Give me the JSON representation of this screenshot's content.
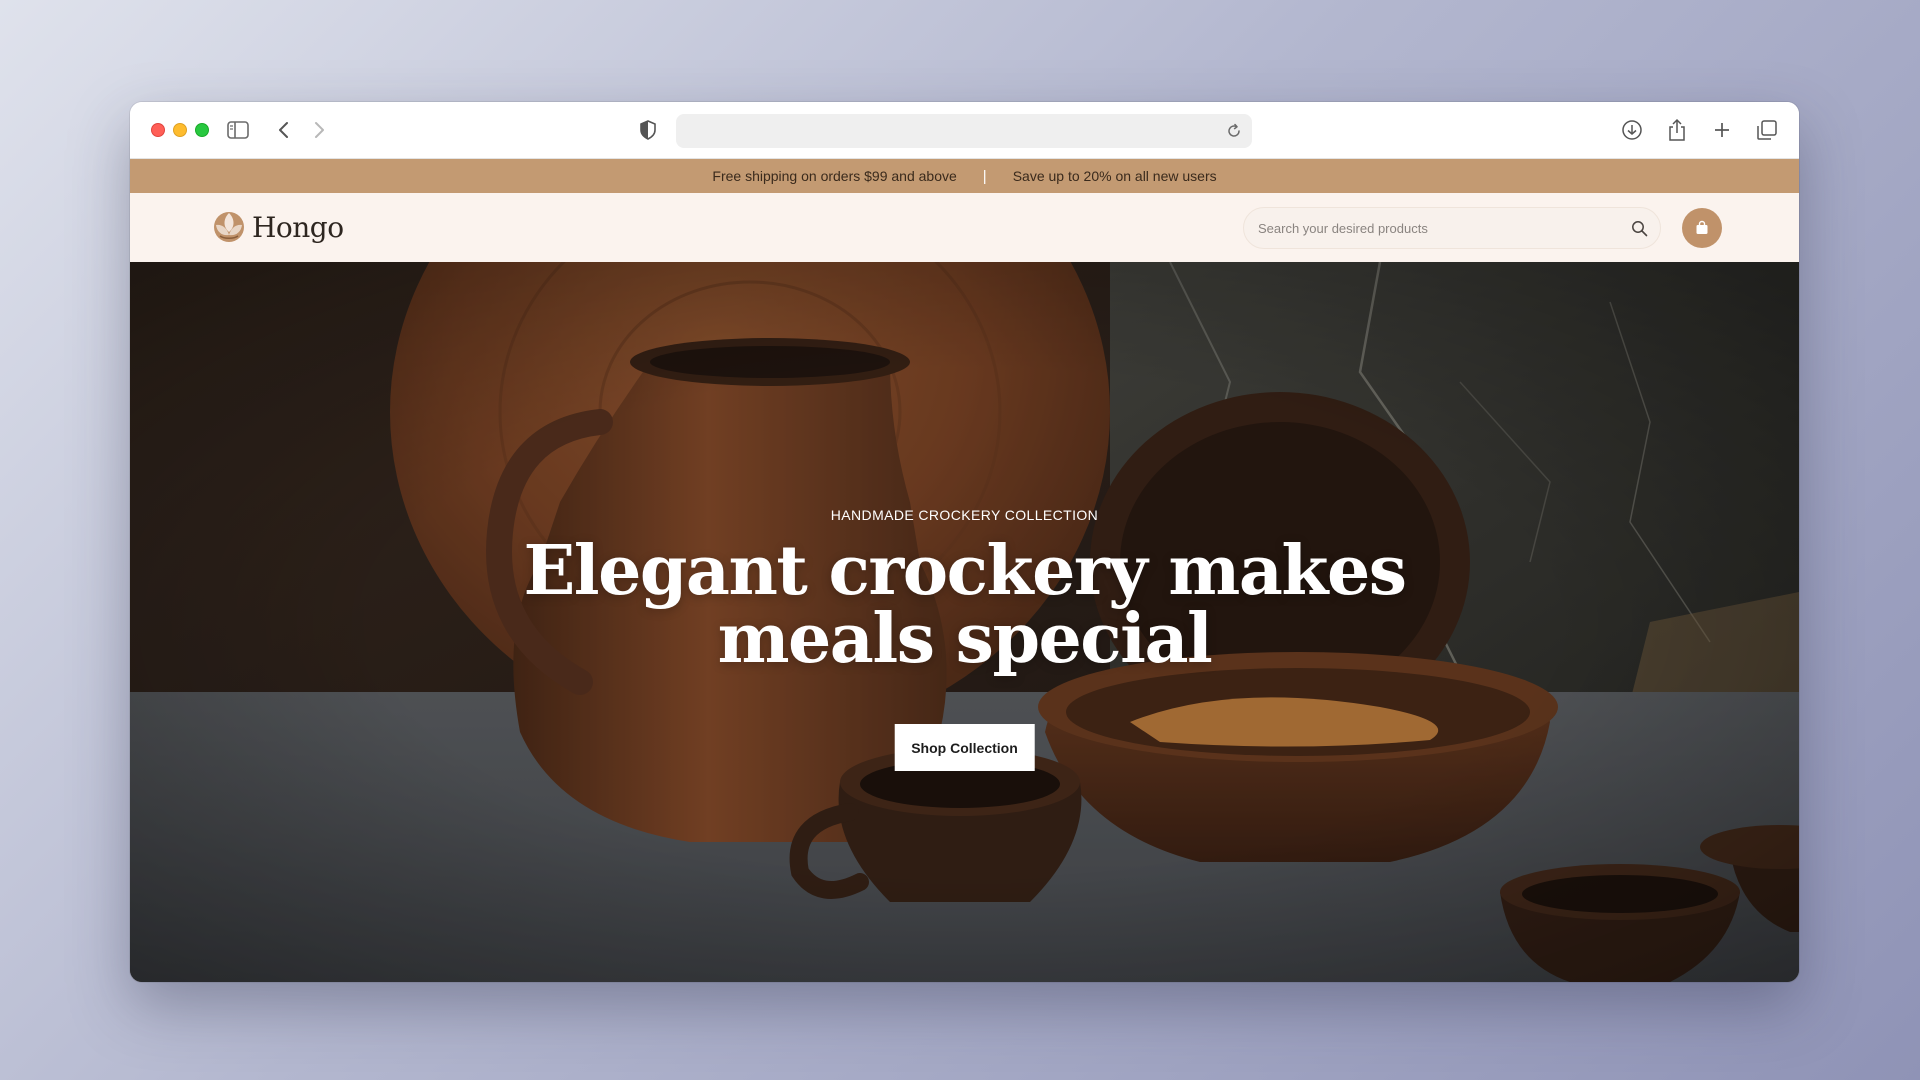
{
  "browser": {
    "address_value": "",
    "icons": [
      "sidebar-icon",
      "back-icon",
      "forward-icon",
      "shield-icon",
      "reload-icon",
      "download-icon",
      "share-icon",
      "new-tab-icon",
      "tabs-overview-icon"
    ]
  },
  "promo": {
    "shipping": "Free shipping on orders $99 and above",
    "separator": "|",
    "discount": "Save up to 20% on all new users"
  },
  "header": {
    "logo_text": "Hongo",
    "search_placeholder": "Search your desired products"
  },
  "hero": {
    "eyebrow": "HANDMADE CROCKERY COLLECTION",
    "headline": "Elegant crockery makes meals special",
    "cta_label": "Shop Collection"
  },
  "colors": {
    "promo_bar": "#c39a72",
    "header_bg": "#fbf3ee",
    "cart_button": "#c0926a",
    "hero_text": "#ffffff"
  }
}
